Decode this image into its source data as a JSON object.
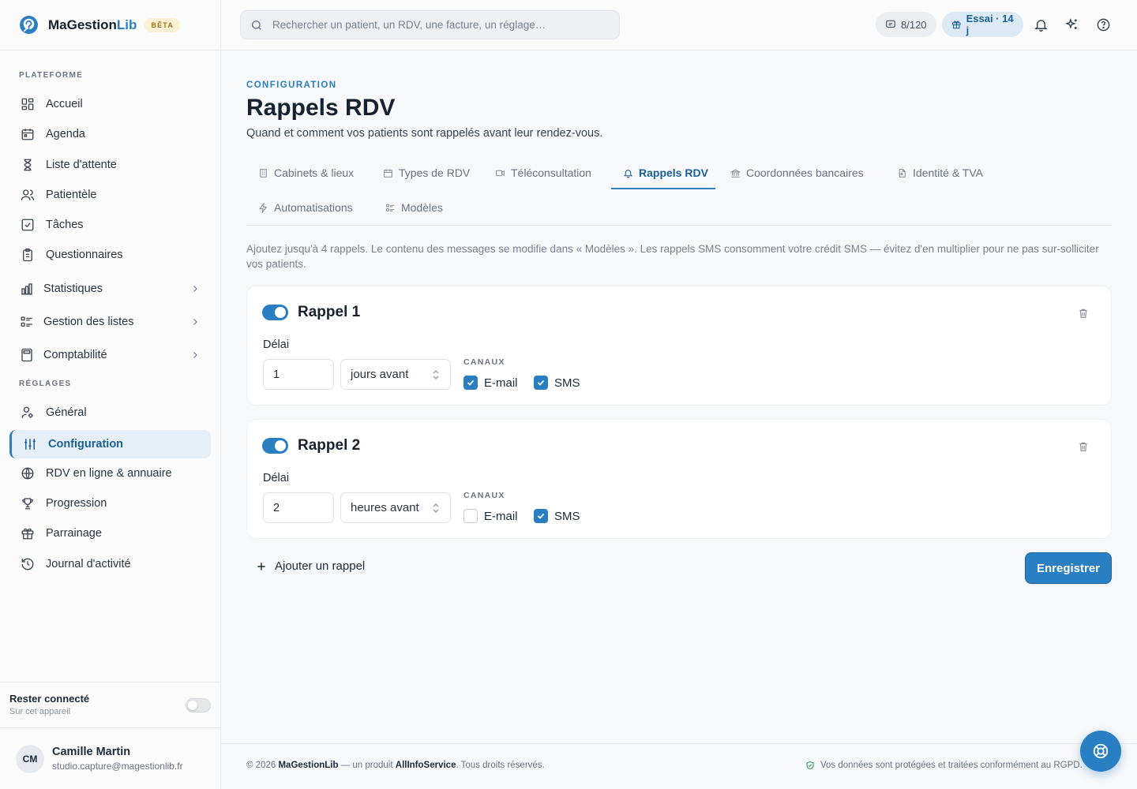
{
  "brand": {
    "name_main": "MaGestion",
    "name_accent": "Lib",
    "badge": "BÊTA"
  },
  "search": {
    "placeholder": "Rechercher un patient, un RDV, une facture, un réglage…"
  },
  "topbar": {
    "sms_counter": "8/120",
    "trial_label": "Essai · 14 j",
    "icons": [
      "message-icon",
      "gift-icon",
      "bell-icon",
      "sparkles-icon",
      "help-circle-icon"
    ]
  },
  "sidebar": {
    "section_platform": "PLATEFORME",
    "section_settings": "RÉGLAGES",
    "platform_items": [
      {
        "label": "Accueil",
        "icon": "dashboard-icon"
      },
      {
        "label": "Agenda",
        "icon": "calendar-icon"
      },
      {
        "label": "Liste d'attente",
        "icon": "hourglass-icon"
      },
      {
        "label": "Patientèle",
        "icon": "users-icon"
      },
      {
        "label": "Tâches",
        "icon": "checkbox-icon"
      },
      {
        "label": "Questionnaires",
        "icon": "clipboard-icon"
      }
    ],
    "group_items": [
      {
        "label": "Statistiques",
        "icon": "bar-chart-icon"
      },
      {
        "label": "Gestion des listes",
        "icon": "list-icon"
      },
      {
        "label": "Comptabilité",
        "icon": "calculator-icon"
      }
    ],
    "settings_items": [
      {
        "label": "Général",
        "icon": "user-cog-icon"
      },
      {
        "label": "Configuration",
        "icon": "sliders-icon",
        "active": true
      },
      {
        "label": "RDV en ligne & annuaire",
        "icon": "globe-icon"
      },
      {
        "label": "Progression",
        "icon": "trophy-icon"
      },
      {
        "label": "Parrainage",
        "icon": "gift-icon"
      },
      {
        "label": "Journal d'activité",
        "icon": "history-icon"
      }
    ],
    "stay_connected": {
      "title": "Rester connecté",
      "subtitle": "Sur cet appareil",
      "enabled": false
    },
    "user": {
      "initials": "CM",
      "name": "Camille Martin",
      "email": "studio.capture@magestionlib.fr"
    }
  },
  "page": {
    "eyebrow": "CONFIGURATION",
    "title": "Rappels RDV",
    "subtitle": "Quand et comment vos patients sont rappelés avant leur rendez-vous.",
    "tabs": [
      {
        "label": "Cabinets & lieux",
        "icon": "building-icon"
      },
      {
        "label": "Types de RDV",
        "icon": "calendar-icon"
      },
      {
        "label": "Téléconsultation",
        "icon": "video-icon"
      },
      {
        "label": "Rappels RDV",
        "icon": "bell-icon",
        "active": true
      },
      {
        "label": "Coordonnées bancaires",
        "icon": "bank-icon"
      },
      {
        "label": "Identité & TVA",
        "icon": "file-icon"
      },
      {
        "label": "Automatisations",
        "icon": "zap-icon"
      },
      {
        "label": "Modèles",
        "icon": "template-icon"
      }
    ],
    "hint": "Ajoutez jusqu'à 4 rappels. Le contenu des messages se modifie dans « Modèles ». Les rappels SMS consomment votre crédit SMS — évitez d'en multiplier pour ne pas sur-solliciter vos patients."
  },
  "reminders": [
    {
      "title": "Rappel 1",
      "enabled": true,
      "delay_label": "Délai",
      "delay_value": "1",
      "unit": "jours avant",
      "channels_label": "CANAUX",
      "email_label": "E-mail",
      "email": true,
      "sms_label": "SMS",
      "sms": true
    },
    {
      "title": "Rappel 2",
      "enabled": true,
      "delay_label": "Délai",
      "delay_value": "2",
      "unit": "heures avant",
      "channels_label": "CANAUX",
      "email_label": "E-mail",
      "email": false,
      "sms_label": "SMS",
      "sms": true
    }
  ],
  "actions": {
    "add_reminder": "Ajouter un rappel",
    "save": "Enregistrer"
  },
  "footer": {
    "year": "© 2026",
    "brand": "MaGestionLib",
    "middle": "— un produit",
    "company": "AllInfoService",
    "rights": ". Tous droits réservés.",
    "privacy": "Vos données sont protégées et traitées conformément au RGPD."
  },
  "colors": {
    "accent": "#2a7fc2",
    "accent_dark": "#1a5f95",
    "beta_bg": "#fbf1d5"
  }
}
